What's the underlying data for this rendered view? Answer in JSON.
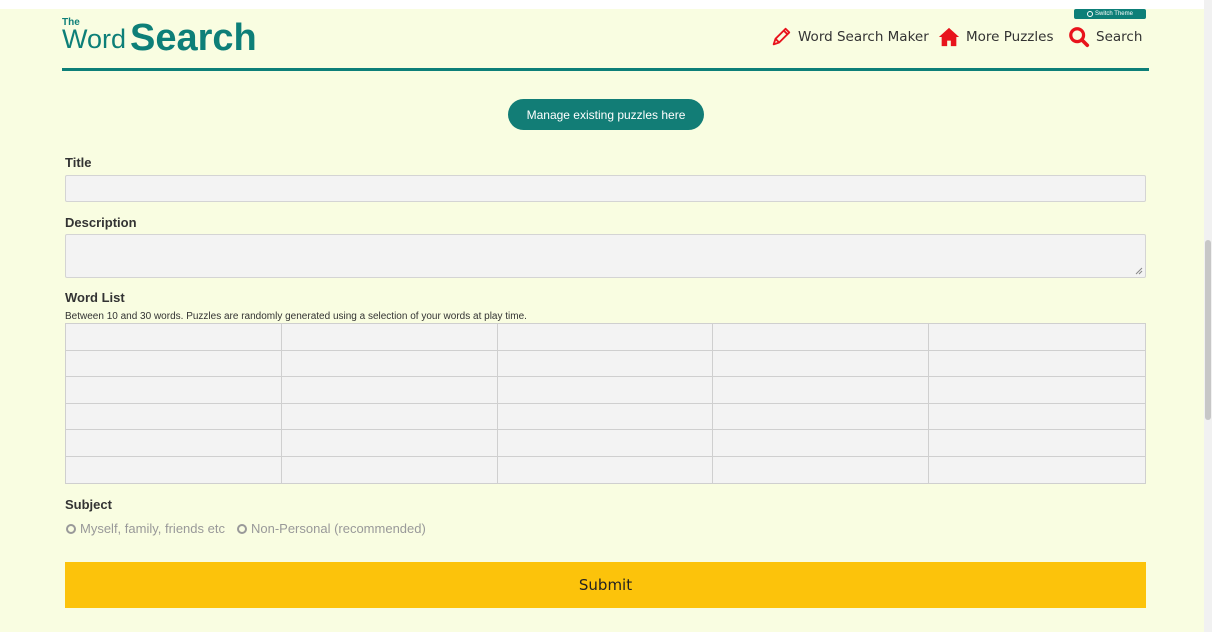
{
  "header": {
    "logo_the": "The",
    "logo_word": "Word",
    "logo_search": "Search",
    "switch_theme": "Switch Theme",
    "nav": [
      {
        "label": "Word Search Maker",
        "icon": "pencil-icon"
      },
      {
        "label": "More Puzzles",
        "icon": "home-icon"
      },
      {
        "label": "Search",
        "icon": "search-icon"
      }
    ]
  },
  "manage_button": "Manage existing puzzles here",
  "form": {
    "title_label": "Title",
    "title_value": "",
    "description_label": "Description",
    "description_value": "",
    "word_list_label": "Word List",
    "word_list_help": "Between 10 and 30 words. Puzzles are randomly generated using a selection of your words at play time.",
    "subject_label": "Subject",
    "subject_options": [
      "Myself, family, friends etc",
      "Non-Personal (recommended)"
    ],
    "submit_label": "Submit"
  },
  "colors": {
    "brand": "#0d7f78",
    "background": "#f9fde1",
    "submit": "#fcc30b",
    "icon_red": "#e8131c"
  }
}
